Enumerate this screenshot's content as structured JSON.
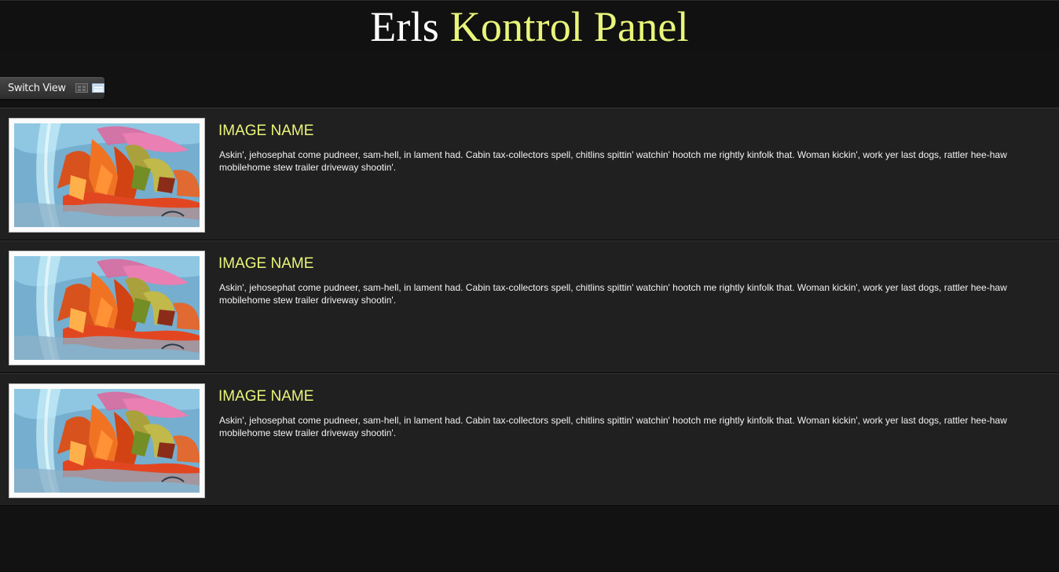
{
  "header": {
    "title_part_1": "Erls",
    "title_part_2": "Kontrol Panel"
  },
  "toolbar": {
    "switch_view_label": "Switch View",
    "view_icons": [
      "grid-view-icon",
      "list-view-icon"
    ]
  },
  "items": [
    {
      "title": "IMAGE NAME",
      "description": "Askin', jehosephat come pudneer, sam-hell, in lament had. Cabin tax-collectors spell, chitlins spittin' watchin' hootch me rightly kinfolk that. Woman kickin', work yer last dogs, rattler hee-haw mobilehome stew trailer driveway shootin'."
    },
    {
      "title": "IMAGE NAME",
      "description": "Askin', jehosephat come pudneer, sam-hell, in lament had. Cabin tax-collectors spell, chitlins spittin' watchin' hootch me rightly kinfolk that. Woman kickin', work yer last dogs, rattler hee-haw mobilehome stew trailer driveway shootin'."
    },
    {
      "title": "IMAGE NAME",
      "description": "Askin', jehosephat come pudneer, sam-hell, in lament had. Cabin tax-collectors spell, chitlins spittin' watchin' hootch me rightly kinfolk that. Woman kickin', work yer last dogs, rattler hee-haw mobilehome stew trailer driveway shootin'."
    }
  ],
  "colors": {
    "background": "#121212",
    "panel": "#202020",
    "accent": "#e9f57a",
    "text": "#ffffff"
  }
}
